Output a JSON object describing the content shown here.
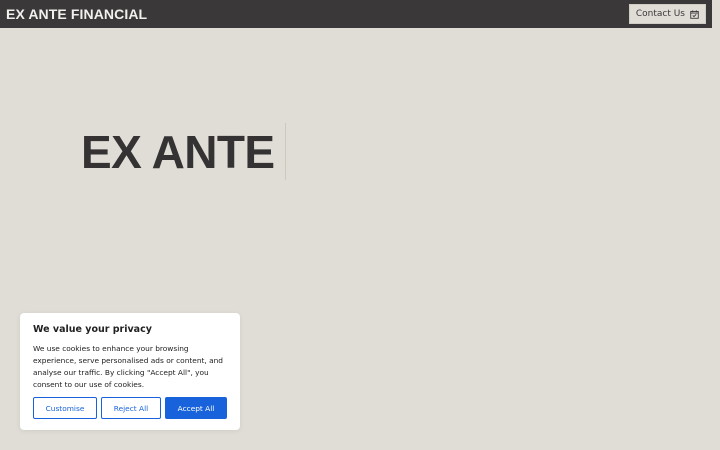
{
  "header": {
    "brand": "EX ANTE FINANCIAL",
    "contact_label": "Contact Us",
    "contact_icon": "calendar-check-icon"
  },
  "hero": {
    "title": "EX ANTE"
  },
  "cookie_banner": {
    "title": "We value your privacy",
    "body": "We use cookies to enhance your browsing experience, serve personalised ads or content, and analyse our traffic. By clicking \"Accept All\", you consent to our use of cookies.",
    "buttons": {
      "customise": "Customise",
      "reject": "Reject All",
      "accept": "Accept All"
    }
  },
  "colors": {
    "background": "#e0ddd6",
    "header": "#3a3839",
    "accent": "#1863dc"
  }
}
